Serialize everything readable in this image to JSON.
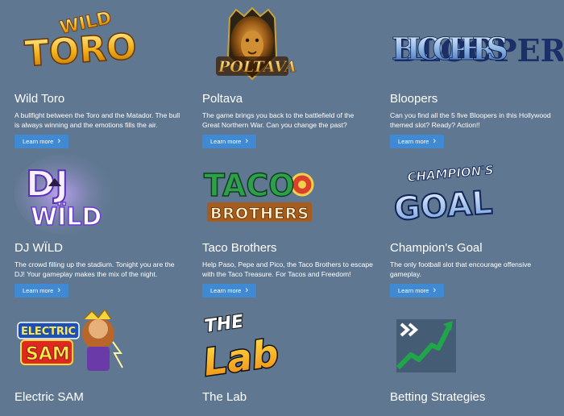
{
  "colors": {
    "background": "#5f7790",
    "button": "#3f8ad3",
    "text": "#ffffff"
  },
  "games": [
    {
      "title": "Wild Toro",
      "description": "A bullfight between the Toro and the Matador. The bull is always winning and the emotions fills the air.",
      "button_label": "Learn more",
      "logo_text": [
        "WILD",
        "TORO"
      ],
      "icon": "wild-toro-logo"
    },
    {
      "title": "Poltava",
      "description": "The game brings you back to the battlefield of the Great Northern War. Can you change the past?",
      "button_label": "Learn more",
      "logo_text": [
        "POLTAVA"
      ],
      "icon": "poltava-lion-logo"
    },
    {
      "title": "Bloopers",
      "description": "Can you find all the 5 five Bloopers in this Hollywood themed slot? Ready? Action!!",
      "button_label": "Learn more",
      "logo_text": [
        "BLOOPERS"
      ],
      "icon": "bloopers-logo"
    },
    {
      "title": "DJ WÏLD",
      "description": "The crowd filling up the stadium. Tonight you are the DJ! Your gameplay makes the mix of the night.",
      "button_label": "Learn more",
      "logo_text": [
        "DJ",
        "WÏLD"
      ],
      "icon": "dj-wild-logo"
    },
    {
      "title": "Taco Brothers",
      "description": "Help Paso, Pepe and Pico, the Taco Brothers to escape with the Taco Treasure. For Tacos and Freedom!",
      "button_label": "Learn more",
      "logo_text": [
        "TACO",
        "BROTHERS"
      ],
      "icon": "taco-brothers-logo"
    },
    {
      "title": "Champion's Goal",
      "description": "The only football slot that encourage offensive gameplay.",
      "button_label": "Learn more",
      "logo_text": [
        "CHAMPION'S",
        "GOAL"
      ],
      "icon": "champions-goal-logo"
    },
    {
      "title": "Electric SAM",
      "description": "",
      "button_label": "",
      "logo_text": [
        "ELECTRIC",
        "SAM"
      ],
      "icon": "electric-sam-logo"
    },
    {
      "title": "The Lab",
      "description": "",
      "button_label": "",
      "logo_text": [
        "THE",
        "Lab"
      ],
      "icon": "the-lab-logo"
    },
    {
      "title": "Betting Strategies",
      "description": "",
      "button_label": "",
      "logo_text": [],
      "icon": "betting-strategies-chart-icon"
    }
  ]
}
